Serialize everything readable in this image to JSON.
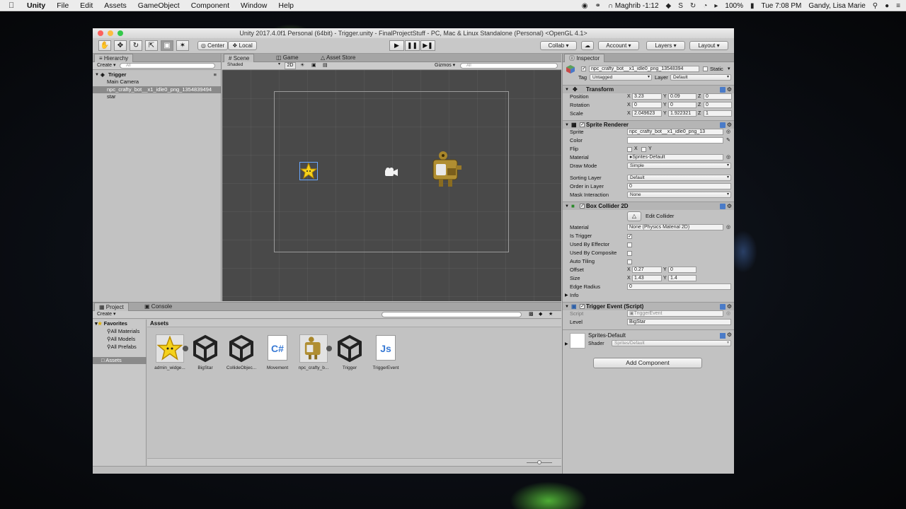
{
  "menubar": {
    "app_name": "Unity",
    "items": [
      "File",
      "Edit",
      "Assets",
      "GameObject",
      "Component",
      "Window",
      "Help"
    ],
    "prayer": "Maghrib -1:12",
    "battery": "100%",
    "clock": "Tue 7:08 PM",
    "user": "Gandy, Lisa Marie"
  },
  "window": {
    "title": "Unity 2017.4.0f1 Personal (64bit) - Trigger.unity - FinalProjectStuff - PC, Mac & Linux Standalone (Personal) <OpenGL 4.1>"
  },
  "toolbar": {
    "pivot": "Center",
    "space": "Local",
    "collab": "Collab",
    "account": "Account",
    "layers": "Layers",
    "layout": "Layout"
  },
  "hierarchy": {
    "tab": "Hierarchy",
    "create": "Create",
    "search_placeholder": "All",
    "scene_name": "Trigger",
    "items": [
      "Main Camera",
      "npc_crafty_bot__x1_idle0_png_1354839494",
      "star"
    ]
  },
  "scene": {
    "tabs": [
      "Scene",
      "Game",
      "Asset Store"
    ],
    "shading": "Shaded",
    "mode_2d": "2D",
    "gizmos": "Gizmos",
    "search_placeholder": "All"
  },
  "inspector": {
    "tab": "Inspector",
    "object_name": "npc_crafty_bot__x1_idle0_png_13548394",
    "static": "Static",
    "tag_label": "Tag",
    "tag": "Untagged",
    "layer_label": "Layer",
    "layer": "Default",
    "transform": {
      "title": "Transform",
      "position_label": "Position",
      "position": [
        "3.23",
        "0.09",
        "0"
      ],
      "rotation_label": "Rotation",
      "rotation": [
        "0",
        "0",
        "0"
      ],
      "scale_label": "Scale",
      "scale": [
        "2.049623",
        "1.922321",
        "1"
      ]
    },
    "sprite_renderer": {
      "title": "Sprite Renderer",
      "sprite_label": "Sprite",
      "sprite": "npc_crafty_bot__x1_idle0_png_13",
      "color_label": "Color",
      "flip_label": "Flip",
      "flip_x": "X",
      "flip_y": "Y",
      "material_label": "Material",
      "material": "Sprites-Default",
      "draw_mode_label": "Draw Mode",
      "draw_mode": "Simple",
      "sorting_layer_label": "Sorting Layer",
      "sorting_layer": "Default",
      "order_label": "Order in Layer",
      "order": "0",
      "mask_label": "Mask Interaction",
      "mask": "None"
    },
    "box_collider": {
      "title": "Box Collider 2D",
      "edit_collider": "Edit Collider",
      "material_label": "Material",
      "material": "None (Physics Material 2D)",
      "is_trigger_label": "Is Trigger",
      "is_trigger": true,
      "effector_label": "Used By Effector",
      "composite_label": "Used By Composite",
      "auto_tiling_label": "Auto Tiling",
      "offset_label": "Offset",
      "offset": [
        "0.27",
        "0"
      ],
      "size_label": "Size",
      "size": [
        "1.43",
        "1.4"
      ],
      "edge_radius_label": "Edge Radius",
      "edge_radius": "0",
      "info_label": "Info"
    },
    "trigger_event": {
      "title": "Trigger Event (Script)",
      "script_label": "Script",
      "script": "TriggerEvent",
      "level_label": "Level",
      "level": "BigStar"
    },
    "material_preview": {
      "name": "Sprites-Default",
      "shader_label": "Shader",
      "shader": "Sprites/Default"
    },
    "add_component": "Add Component"
  },
  "project": {
    "tabs": [
      "Project",
      "Console"
    ],
    "create": "Create",
    "favorites_label": "Favorites",
    "favorites": [
      "All Materials",
      "All Models",
      "All Prefabs"
    ],
    "assets_folder": "Assets",
    "breadcrumb": "Assets",
    "assets": [
      {
        "name": "admin_widge...",
        "icon": "star-sprite-icon"
      },
      {
        "name": "BigStar",
        "icon": "unity-scene-icon"
      },
      {
        "name": "CollideObjec...",
        "icon": "unity-scene-icon"
      },
      {
        "name": "Movement",
        "icon": "csharp-script-icon"
      },
      {
        "name": "npc_crafty_b...",
        "icon": "robot-sprite-icon"
      },
      {
        "name": "Trigger",
        "icon": "unity-scene-icon"
      },
      {
        "name": "TriggerEvent",
        "icon": "js-script-icon"
      }
    ]
  },
  "labels": {
    "x": "X",
    "y": "Y",
    "z": "Z"
  }
}
